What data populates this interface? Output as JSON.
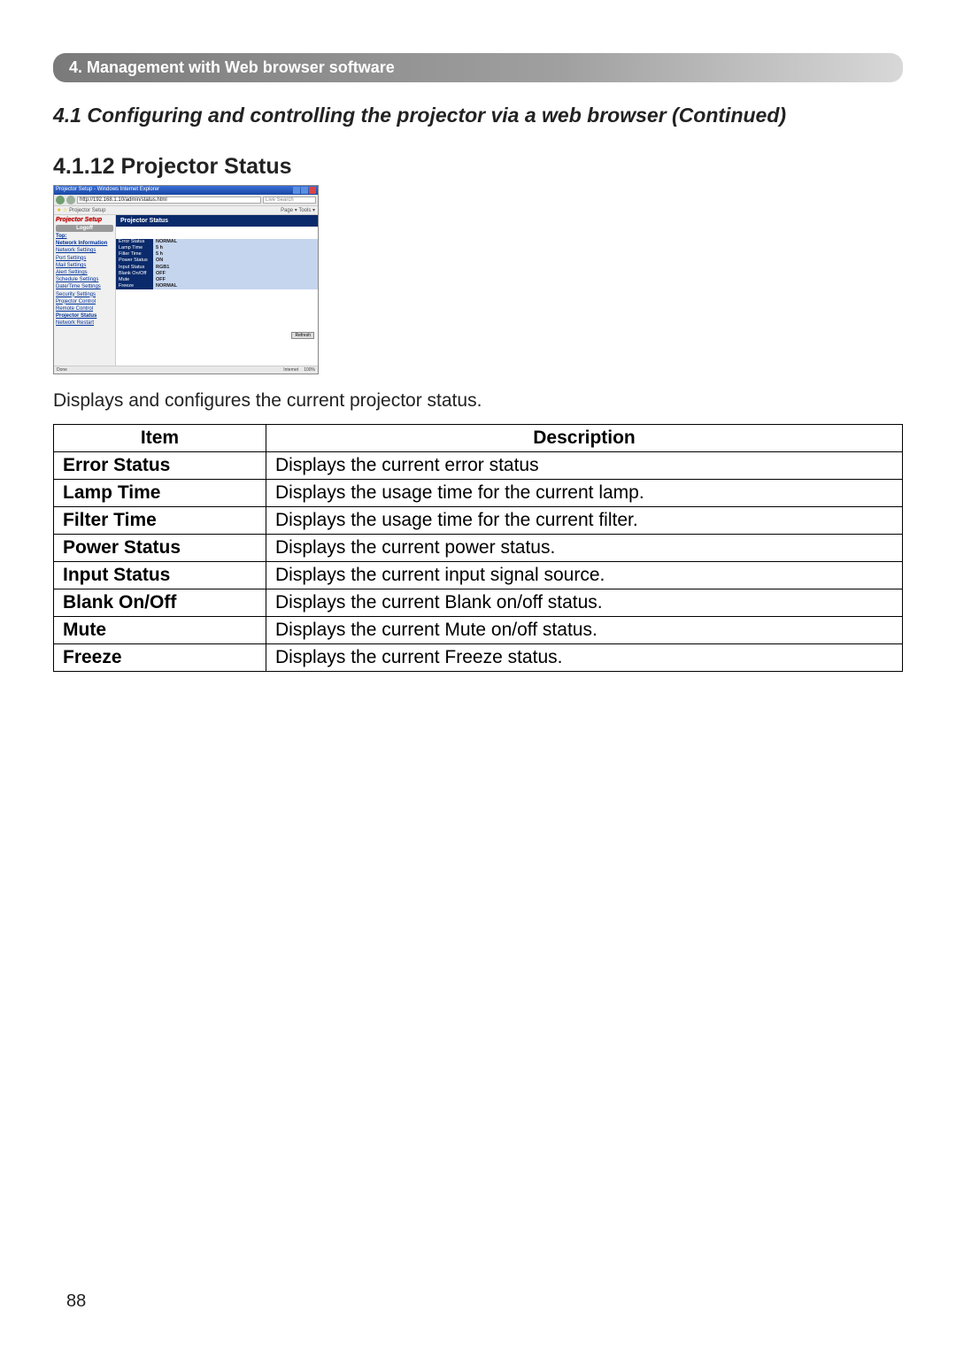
{
  "section_bar": "4. Management with Web browser software",
  "section_title": "4.1 Configuring and controlling the projector via a web browser (Continued)",
  "subsection_title": "4.1.12 Projector Status",
  "intro_text": "Displays and configures the current projector status.",
  "table_headers": {
    "item": "Item",
    "description": "Description"
  },
  "rows": [
    {
      "item": "Error Status",
      "desc": "Displays the current error status"
    },
    {
      "item": "Lamp Time",
      "desc": "Displays the usage time for the current lamp."
    },
    {
      "item": "Filter Time",
      "desc": "Displays the usage time for the current filter."
    },
    {
      "item": "Power Status",
      "desc": "Displays the current power status."
    },
    {
      "item": "Input Status",
      "desc": "Displays the current input signal source."
    },
    {
      "item": "Blank On/Off",
      "desc": "Displays the current Blank on/off status."
    },
    {
      "item": "Mute",
      "desc": "Displays the current Mute on/off status."
    },
    {
      "item": "Freeze",
      "desc": "Displays the current Freeze status."
    }
  ],
  "page_number": "88",
  "screenshot": {
    "window_title": "Projector Setup - Windows Internet Explorer",
    "url": "http://192.168.1.10/admin/status.html",
    "search_placeholder": "Live Search",
    "tab_label": "Projector Setup",
    "toolbar_right": "Page ▾  Tools ▾",
    "sidebar_title": "Projector Setup",
    "logoff": "Logoff",
    "sidebar_links": [
      "Top:",
      "Network Information",
      "Network Settings",
      "Port Settings",
      "Mail Settings",
      "Alert Settings",
      "Schedule Settings",
      "Date/Time Settings",
      "Security Settings",
      "Projector Control",
      "Remote Control",
      "Projector Status",
      "Network Restart"
    ],
    "main_header": "Projector Status",
    "status": [
      {
        "label": "Error Status",
        "value": "NORMAL"
      },
      {
        "label": "Lamp Time",
        "value": "5 h"
      },
      {
        "label": "Filter Time",
        "value": "5 h"
      },
      {
        "label": "Power Status",
        "value": "ON"
      },
      {
        "label": "Input Status",
        "value": "RGB1"
      },
      {
        "label": "Blank On/Off",
        "value": "OFF"
      },
      {
        "label": "Mute",
        "value": "OFF"
      },
      {
        "label": "Freeze",
        "value": "NORMAL"
      }
    ],
    "refresh_btn": "Refresh",
    "statusbar_left": "Done",
    "statusbar_internet": "Internet",
    "statusbar_zoom": "100%"
  }
}
